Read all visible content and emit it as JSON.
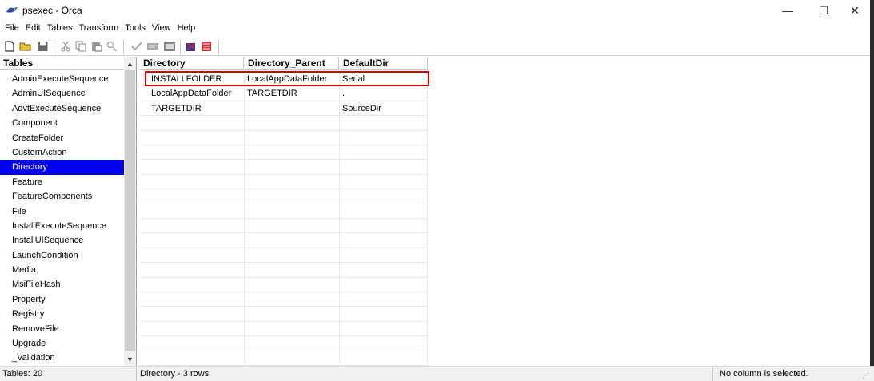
{
  "window": {
    "title": "psexec - Orca",
    "minimize_glyph": "—",
    "maximize_glyph": "☐",
    "close_glyph": "✕"
  },
  "menu": [
    "File",
    "Edit",
    "Tables",
    "Transform",
    "Tools",
    "View",
    "Help"
  ],
  "toolbar": {
    "icons": [
      "new-file-icon",
      "open-folder-icon",
      "save-icon",
      "cut-icon",
      "copy-icon",
      "paste-icon",
      "find-icon",
      "validate-icon",
      "summary-info-icon",
      "merge-module-icon",
      "transform-icon",
      "patch-icon"
    ]
  },
  "tables_pane": {
    "header": "Tables",
    "selected": "Directory",
    "items": [
      "AdminExecuteSequence",
      "AdminUISequence",
      "AdvtExecuteSequence",
      "Component",
      "CreateFolder",
      "CustomAction",
      "Directory",
      "Feature",
      "FeatureComponents",
      "File",
      "InstallExecuteSequence",
      "InstallUISequence",
      "LaunchCondition",
      "Media",
      "MsiFileHash",
      "Property",
      "Registry",
      "RemoveFile",
      "Upgrade",
      "_Validation"
    ]
  },
  "grid": {
    "columns": [
      "Directory",
      "Directory_Parent",
      "DefaultDir"
    ],
    "rows": [
      [
        "INSTALLFOLDER",
        "LocalAppDataFolder",
        "Serial"
      ],
      [
        "LocalAppDataFolder",
        "TARGETDIR",
        "."
      ],
      [
        "TARGETDIR",
        "",
        "SourceDir"
      ]
    ],
    "highlight_color": "#e00000"
  },
  "status": {
    "tables_count": "Tables: 20",
    "row_info": "Directory - 3 rows",
    "column_info": "No column is selected."
  },
  "colors": {
    "selection": "#0000ee",
    "highlight": "#e00000"
  }
}
